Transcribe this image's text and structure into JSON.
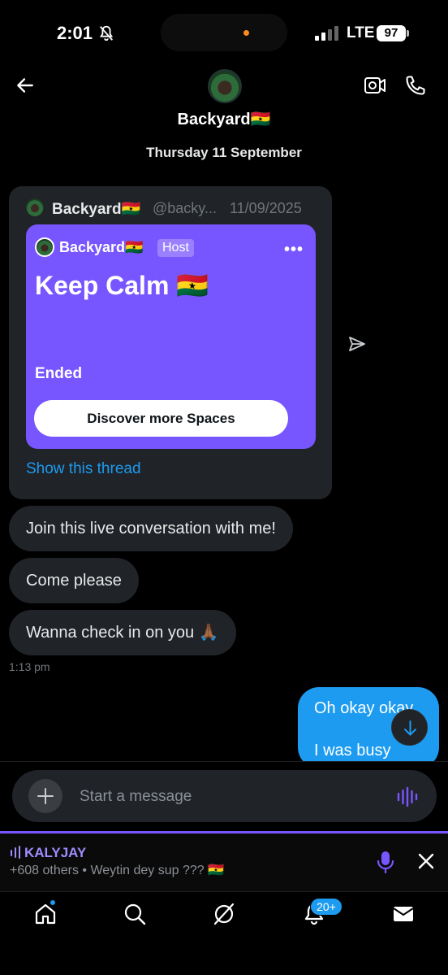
{
  "status_bar": {
    "time": "2:01",
    "network": "LTE",
    "battery": "97",
    "icons": [
      "bell-muted-icon",
      "signal-bars-icon",
      "battery-icon"
    ]
  },
  "header": {
    "name": "Backyard🇬🇭",
    "icons": [
      "back-arrow-icon",
      "video-call-icon",
      "phone-call-icon"
    ]
  },
  "date_separator": "Thursday 11 September",
  "shared_post": {
    "author": "Backyard🇬🇭",
    "handle": "@backy...",
    "date": "11/09/2025",
    "space": {
      "host_name": "Backyard🇬🇭",
      "host_badge": "Host",
      "more": "•••",
      "title": "Keep Calm 🇬🇭",
      "status": "Ended",
      "cta": "Discover more Spaces"
    },
    "show_thread": "Show this thread"
  },
  "messages_in": [
    {
      "text": "Join this live conversation with me!"
    },
    {
      "text": "Come please"
    },
    {
      "text": "Wanna check in on you 🙏🏾"
    }
  ],
  "messages_in_time": "1:13 pm",
  "messages_out": {
    "line1": "Oh okay okay",
    "line2": "I was busy"
  },
  "composer": {
    "placeholder": "Start a message"
  },
  "live_space": {
    "host": "KALYJAY",
    "subtitle": "+608 others • Weytin dey sup ??? 🇬🇭"
  },
  "tabbar": {
    "notifications_badge": "20+",
    "tabs": [
      "home-icon",
      "search-icon",
      "grok-icon",
      "notifications-icon",
      "messages-icon"
    ]
  },
  "colors": {
    "accent": "#1d9bf0",
    "spaces_purple": "#7856ff",
    "bubble_gray": "#202327"
  }
}
